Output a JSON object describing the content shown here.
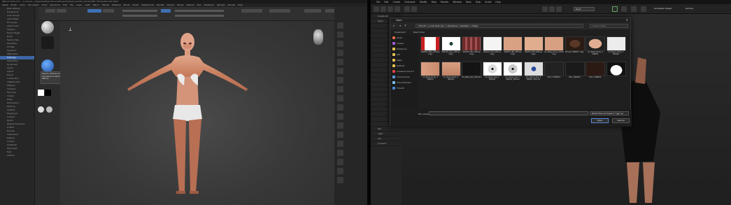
{
  "zbrush": {
    "title": "ZBrush 2021.6.6 — C:\\Users\\...\\Desktop\\ProjectSource\\Projects\\Head_SubTool_Model.ZPR *Stroke-Bt:Leaf+Edit*",
    "menu": [
      "Alpha",
      "Brush",
      "Color",
      "Document",
      "Draw",
      "Dynamics",
      "Edit",
      "File",
      "Layer",
      "Light",
      "Macro",
      "Marker",
      "Material",
      "Movie",
      "Picker",
      "Preferences",
      "Render",
      "Stencil",
      "Stroke",
      "Texture",
      "Tool",
      "Transform",
      "Zplugin",
      "Zscript",
      "Help"
    ],
    "left_panel": [
      "Best Settings",
      "Transparent",
      "Auto Groups",
      "Auto Flatten",
      "Fill Groups",
      "Adjust Color",
      "Sharpen",
      "Morph Target",
      "Brush",
      "Texture Map",
      "Geometry",
      "UV Map",
      "Polypaint",
      "ZRemesher",
      "Topology",
      "Subdivision",
      "Dynamesh",
      "Layers",
      "Import",
      "Export",
      "Unified Skin",
      "Adaptive Skin",
      "ZSphere",
      "Sculptris",
      "Flat Color",
      "Crease",
      "Polish",
      "Deformation",
      "Masking",
      "Visibility",
      "Polygroups",
      "Contact",
      "Morph",
      "Display Properties",
      "Unified",
      "Preview",
      "Shadowbox",
      "Rigging",
      "Surface",
      "ClayPolish",
      "Fibermesh",
      "Eyes",
      "Subtool"
    ],
    "tooltip": "Simple shadow-ready mode. All shaded surfaces get diffuse",
    "head_thumb_label": "Head"
  },
  "autodesk": {
    "menu": [
      "File",
      "Edit",
      "Create",
      "Character",
      "Modify",
      "View",
      "Render",
      "Window",
      "Tools",
      "Help",
      "Script",
      "Help"
    ],
    "panel_label": "Create",
    "panel_rows": [
      "Create Ob",
      "Open",
      "",
      "",
      "",
      "",
      "",
      "",
      "",
      "",
      "",
      "",
      "",
      "",
      "",
      "",
      "",
      "",
      "",
      "",
      "",
      "",
      "",
      "Rig",
      "Light",
      "Glo",
      "Content"
    ],
    "selector_label": "Rigid",
    "buttons": [
      "Animation Player",
      "Gizmos"
    ],
    "open_dialog": {
      "title": "Open",
      "path": "This PC > Local Disk (D:) > Freelance > Realistic > Maps",
      "search": "Search Maps",
      "commands": [
        "Organize ▾",
        "New folder"
      ],
      "sidebar": [
        {
          "name": "Music",
          "color": "#e06a4a"
        },
        {
          "name": "Videos",
          "color": "#a05ad6"
        },
        {
          "name": "Freelance",
          "color": "#e6c050"
        },
        {
          "name": "SW",
          "color": "#e6c050"
        },
        {
          "name": "Maps",
          "color": "#e6c050"
        },
        {
          "name": "Default",
          "color": "#e6c050"
        },
        {
          "name": "Creative Cloud F",
          "color": "#e04444"
        },
        {
          "name": "iCloud Drive",
          "color": "#5aa0e0"
        },
        {
          "name": "iCloud Photos",
          "color": "#7fc0ef"
        },
        {
          "name": "This PC",
          "color": "#4a8ad8"
        }
      ],
      "files": [
        {
          "name": "260402_Bde_Diffuse copy",
          "kind": "redwhite"
        },
        {
          "name": "260402_Eye_Diffuse copy",
          "kind": "eye"
        },
        {
          "name": "260422_Btl_Diffuse copy",
          "kind": "teeth"
        },
        {
          "name": "260422_Btl_Diffuse copy",
          "kind": "white"
        },
        {
          "name": "260422_Btl_Diffuse copy",
          "kind": "skin"
        },
        {
          "name": "260422_Btl_Diffuse copy",
          "kind": "skin2"
        },
        {
          "name": "CC_Base_Body_Diffuse copy",
          "kind": "skin3"
        },
        {
          "name": "Brows_TRR007 copy",
          "kind": "brows"
        },
        {
          "name": "CC_Base_Body_T MR001",
          "kind": "body"
        },
        {
          "name": "CC_Base_Body_T MR002",
          "kind": "white2"
        },
        {
          "name": "CC_Base_Body_T MR003",
          "kind": "hands"
        },
        {
          "name": "CC_Base_Body_T MR004",
          "kind": "feet"
        },
        {
          "name": "CC_Base_Eye_Texture_Ram_jpg_TRR001",
          "kind": "dark"
        },
        {
          "name": "CC_Base_Eye_T MR003",
          "kind": "iris"
        },
        {
          "name": "CC_Game_Eye_T MR003_Diffuse",
          "kind": "iris2"
        },
        {
          "name": "CC_Game_Eye_T MR003_Normal",
          "kind": "iris3"
        },
        {
          "name": "Skin_T MR001",
          "kind": "dark2"
        },
        {
          "name": "Hair_TRR001",
          "kind": "hairpng"
        },
        {
          "name": "Skin_TRR001",
          "kind": "dark3"
        },
        {
          "name": "",
          "kind": "mask"
        }
      ],
      "file_name_label": "File name:",
      "file_type": "Media Files (All Types) (*.jpg;*.jp",
      "open_label": "Open",
      "cancel_label": "Cancel"
    }
  },
  "colors": {
    "accent_blue": "#3d66a6",
    "skin": "#d79a7a",
    "dress": "#e8e8e8"
  }
}
